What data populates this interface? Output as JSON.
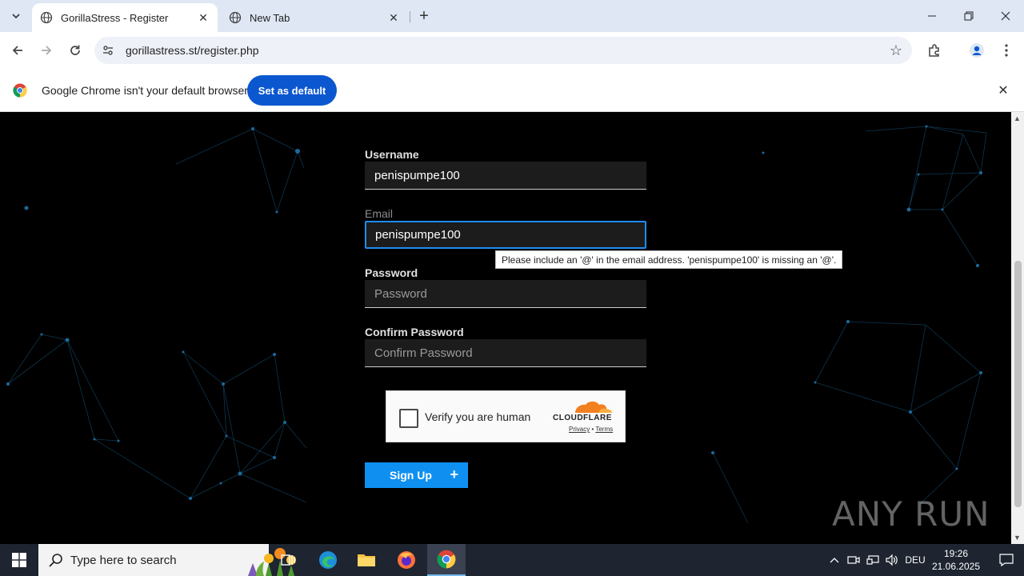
{
  "browser": {
    "tabs": [
      {
        "title": "GorillaStress - Register",
        "active": true
      },
      {
        "title": "New Tab",
        "active": false
      }
    ],
    "url": "gorillastress.st/register.php",
    "infobar": {
      "message": "Google Chrome isn't your default browser",
      "button": "Set as default"
    }
  },
  "form": {
    "username_label": "Username",
    "username_value": "penispumpe100",
    "email_label": "Email",
    "email_value": "penispumpe100",
    "validation_tooltip": "Please include an '@' in the email address. 'penispumpe100' is missing an '@'.",
    "password_label": "Password",
    "password_placeholder": "Password",
    "confirm_label": "Confirm Password",
    "confirm_placeholder": "Confirm Password",
    "captcha": {
      "label": "Verify you are human",
      "provider": "CLOUDFLARE",
      "privacy": "Privacy",
      "sep": "•",
      "terms": "Terms"
    },
    "submit_label": "Sign Up",
    "submit_icon": "+"
  },
  "watermark": "ANY RUN",
  "taskbar": {
    "search_placeholder": "Type here to search",
    "language": "DEU",
    "time": "19:26",
    "date": "21.06.2025"
  },
  "colors": {
    "accent": "#0f90f0",
    "focus_border": "#1d8cf2",
    "chrome_button": "#0b57d0",
    "page_bg": "#000000"
  }
}
